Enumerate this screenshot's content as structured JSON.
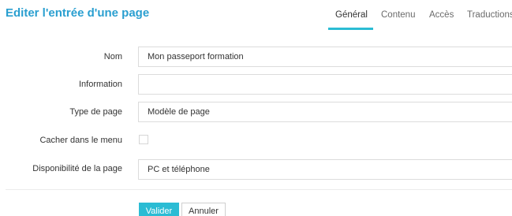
{
  "header": {
    "title": "Editer l'entrée d'une page"
  },
  "tabs": [
    {
      "label": "Général",
      "active": true
    },
    {
      "label": "Contenu",
      "active": false
    },
    {
      "label": "Accès",
      "active": false
    },
    {
      "label": "Traductions",
      "active": false
    }
  ],
  "form": {
    "name": {
      "label": "Nom",
      "value": "Mon passeport formation"
    },
    "information": {
      "label": "Information",
      "value": ""
    },
    "page_type": {
      "label": "Type de page",
      "value": "Modèle de page"
    },
    "hide_in_menu": {
      "label": "Cacher dans le menu",
      "checked": false
    },
    "availability": {
      "label": "Disponibilité de la page",
      "value": "PC et téléphone"
    }
  },
  "actions": {
    "submit_label": "Valider",
    "cancel_label": "Annuler"
  },
  "colors": {
    "accent": "#2bbcd4",
    "title": "#2a9fd0"
  }
}
